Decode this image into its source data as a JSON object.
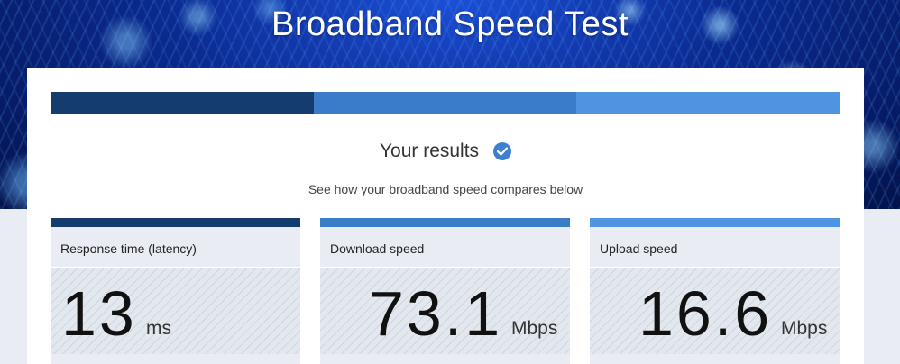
{
  "hero": {
    "title": "Broadband Speed Test"
  },
  "progress": {
    "segments": [
      "#143c6e",
      "#3b7cc8",
      "#4e94e0"
    ]
  },
  "results": {
    "title": "Your results",
    "subtitle": "See how your broadband speed compares below",
    "icon": "check-circle-icon",
    "icon_color": "#3f7fd0"
  },
  "metrics": [
    {
      "label": "Response time (latency)",
      "value": "13",
      "unit": "ms",
      "color": "#143c6e"
    },
    {
      "label": "Download speed",
      "value": "73.1",
      "unit": "Mbps",
      "color": "#3b7cc8"
    },
    {
      "label": "Upload speed",
      "value": "16.6",
      "unit": "Mbps",
      "color": "#4e94e0"
    }
  ]
}
